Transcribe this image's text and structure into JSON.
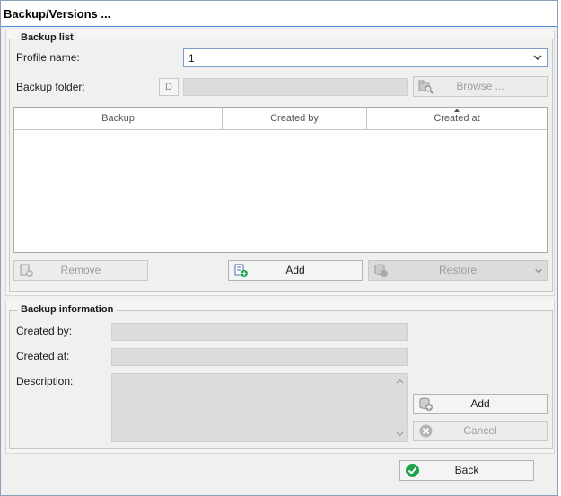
{
  "window": {
    "title": "Backup/Versions ..."
  },
  "backup_list": {
    "legend": "Backup list",
    "profile_label": "Profile name:",
    "profile_value": "1",
    "folder_label": "Backup folder:",
    "drive_letter": "D",
    "browse_label": "Browse ...",
    "columns": [
      "Backup",
      "Created by",
      "Created at"
    ],
    "rows": [],
    "remove_label": "Remove",
    "add_label": "Add",
    "restore_label": "Restore"
  },
  "backup_info": {
    "legend": "Backup information",
    "created_by_label": "Created by:",
    "created_at_label": "Created at:",
    "description_label": "Description:",
    "add_label": "Add",
    "cancel_label": "Cancel"
  },
  "footer": {
    "back_label": "Back"
  },
  "colors": {
    "accent": "#4a90d9",
    "success": "#1aa34a",
    "disabled_text": "#9c9c9c"
  },
  "icons": [
    "folder-search-icon",
    "remove-doc-icon",
    "add-doc-icon",
    "database-add-icon",
    "cancel-icon",
    "check-icon",
    "chevron-down-icon"
  ]
}
